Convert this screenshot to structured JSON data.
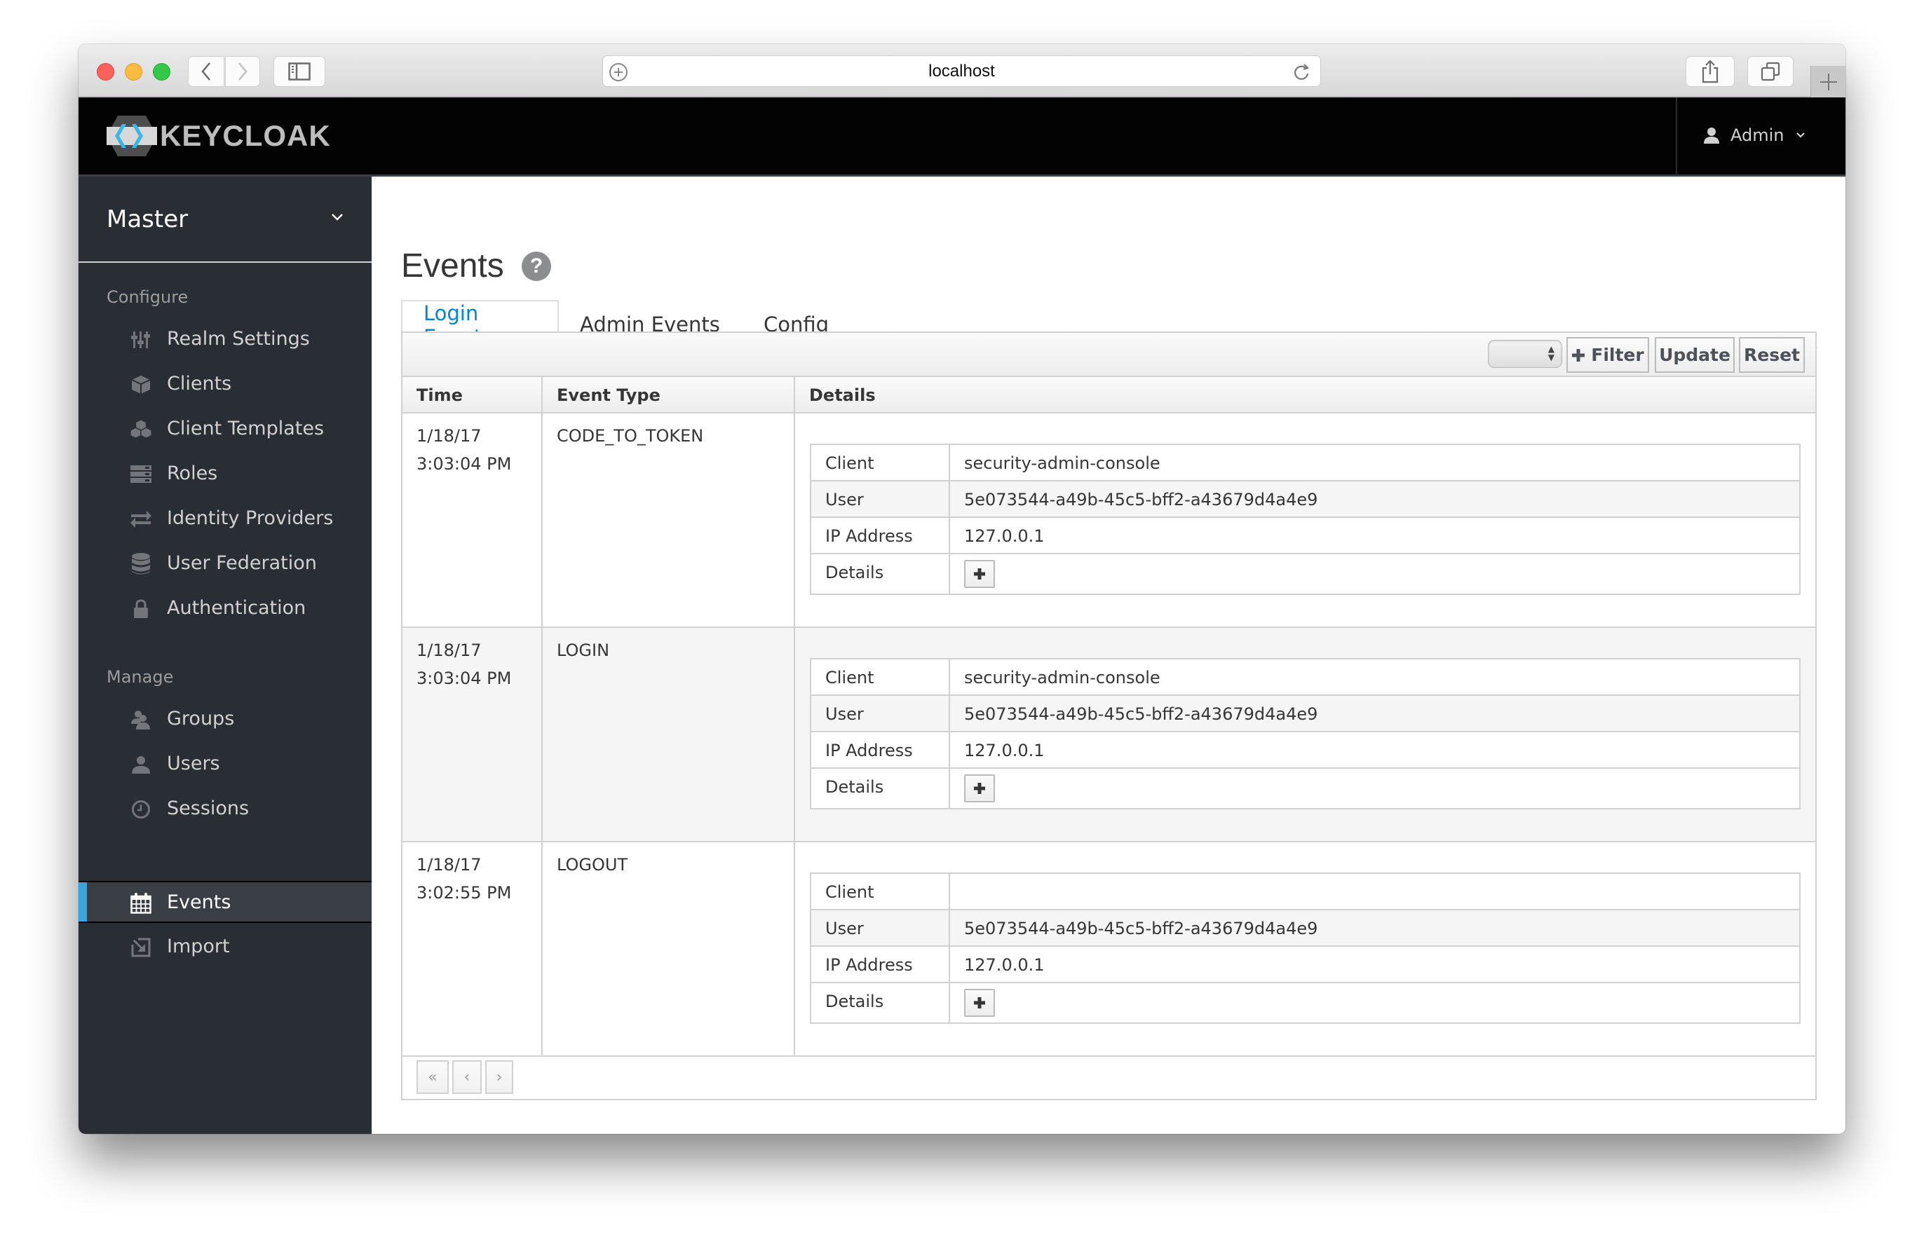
{
  "browser": {
    "url": "localhost"
  },
  "navbar": {
    "brand": "KEYCLOAK",
    "user_label": "Admin"
  },
  "sidebar": {
    "realm": "Master",
    "sections": [
      {
        "label": "Configure",
        "items": [
          {
            "label": "Realm Settings",
            "icon": "sliders-icon"
          },
          {
            "label": "Clients",
            "icon": "cube-icon"
          },
          {
            "label": "Client Templates",
            "icon": "cubes-icon"
          },
          {
            "label": "Roles",
            "icon": "server-icon"
          },
          {
            "label": "Identity Providers",
            "icon": "exchange-icon"
          },
          {
            "label": "User Federation",
            "icon": "database-icon"
          },
          {
            "label": "Authentication",
            "icon": "lock-icon"
          }
        ]
      },
      {
        "label": "Manage",
        "items": [
          {
            "label": "Groups",
            "icon": "users-icon"
          },
          {
            "label": "Users",
            "icon": "user-icon"
          },
          {
            "label": "Sessions",
            "icon": "clock-icon"
          },
          {
            "label": "Events",
            "icon": "calendar-icon",
            "active": true
          },
          {
            "label": "Import",
            "icon": "import-icon"
          }
        ]
      }
    ],
    "accent_color": "#39a5dc"
  },
  "main": {
    "title": "Events",
    "tabs": [
      {
        "label": "Login Events",
        "active": true
      },
      {
        "label": "Admin Events"
      },
      {
        "label": "Config"
      }
    ],
    "toolbar": {
      "max_results_value": "",
      "filter_label": "Filter",
      "update_label": "Update",
      "reset_label": "Reset"
    },
    "table": {
      "columns": [
        "Time",
        "Event Type",
        "Details"
      ],
      "detail_labels": [
        "Client",
        "User",
        "IP Address",
        "Details"
      ],
      "rows": [
        {
          "date": "1/18/17",
          "time": "3:03:04 PM",
          "type": "CODE_TO_TOKEN",
          "client": "security-admin-console",
          "user": "5e073544-a49b-45c5-bff2-a43679d4a4e9",
          "ip": "127.0.0.1"
        },
        {
          "date": "1/18/17",
          "time": "3:03:04 PM",
          "type": "LOGIN",
          "client": "security-admin-console",
          "user": "5e073544-a49b-45c5-bff2-a43679d4a4e9",
          "ip": "127.0.0.1"
        },
        {
          "date": "1/18/17",
          "time": "3:02:55 PM",
          "type": "LOGOUT",
          "client": "",
          "user": "5e073544-a49b-45c5-bff2-a43679d4a4e9",
          "ip": "127.0.0.1"
        }
      ]
    },
    "pagination": {
      "first": "«",
      "prev": "‹",
      "next": "›"
    },
    "link_color": "#0088ce"
  }
}
